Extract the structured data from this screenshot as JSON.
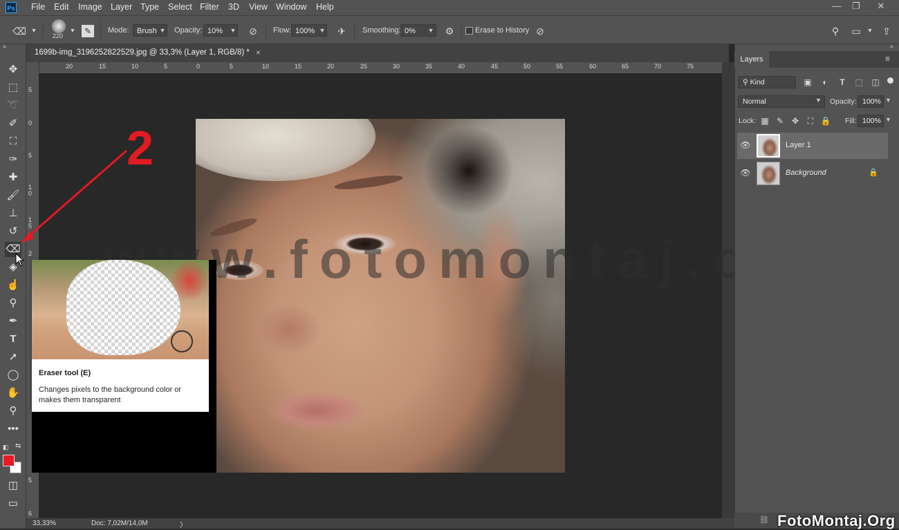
{
  "app": {
    "logo_text": "Ps"
  },
  "menu": {
    "items": [
      "File",
      "Edit",
      "Image",
      "Layer",
      "Type",
      "Select",
      "Filter",
      "3D",
      "View",
      "Window",
      "Help"
    ]
  },
  "window_controls": {
    "minimize": "—",
    "restore": "❐",
    "close": "✕"
  },
  "options_bar": {
    "brush_size": "220",
    "mode_label": "Mode:",
    "mode_value": "Brush",
    "opacity_label": "Opacity:",
    "opacity_value": "10%",
    "flow_label": "Flow:",
    "flow_value": "100%",
    "smoothing_label": "Smoothing:",
    "smoothing_value": "0%",
    "erase_history_label": "Erase to History"
  },
  "document": {
    "tab_title": "1699b-img_3196252822529.jpg @ 33,3% (Layer 1, RGB/8) *",
    "tab_close": "×",
    "ruler_h": [
      "20",
      "15",
      "10",
      "5",
      "0",
      "5",
      "10",
      "15",
      "20",
      "25",
      "30",
      "35",
      "40",
      "45",
      "50",
      "55",
      "60",
      "65",
      "70",
      "75"
    ],
    "ruler_v": [
      "5",
      "0",
      "5",
      "1 0",
      "1 5",
      "2",
      "5",
      "6"
    ],
    "zoom": "33,33%",
    "doc_size": "Doc: 7,02M/14,0M",
    "status_arrow": "〉"
  },
  "watermark_text": "www.fotomontaj.org",
  "annotation": {
    "number": "2"
  },
  "tooltip": {
    "title": "Eraser tool (E)",
    "description": "Changes pixels to the background color or makes them transparent"
  },
  "layers_panel": {
    "tab_label": "Layers",
    "filter_kind": "Kind",
    "blend_mode": "Normal",
    "opacity_label": "Opacity:",
    "opacity_value": "100%",
    "lock_label": "Lock:",
    "fill_label": "Fill:",
    "fill_value": "100%",
    "layers": [
      {
        "name": "Layer 1",
        "selected": true,
        "visible": true
      },
      {
        "name": "Background",
        "selected": false,
        "visible": true,
        "locked": true
      }
    ]
  },
  "bottom_watermark": "FotoMontaj.Org",
  "colors": {
    "foreground": "#e81b23",
    "background": "#ffffff",
    "annotation": "#e11b22"
  }
}
